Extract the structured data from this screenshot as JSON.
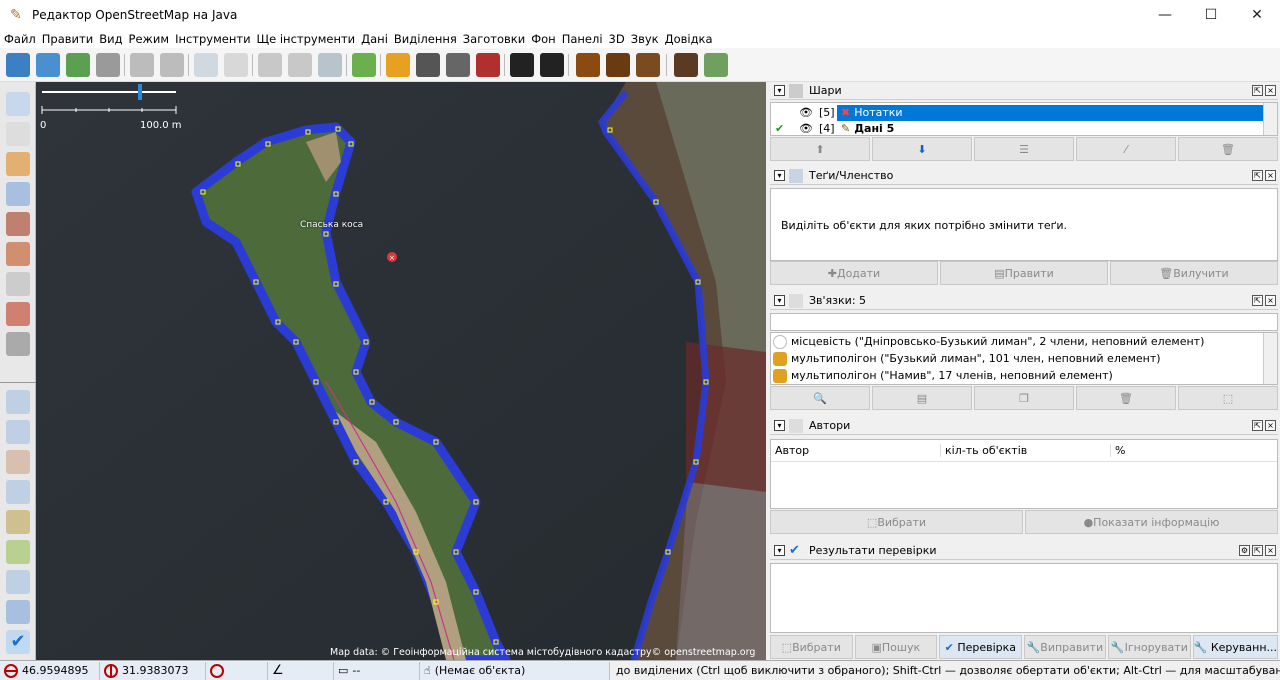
{
  "window": {
    "title": "Редактор OpenStreetMap на Java"
  },
  "menu": [
    "Файл",
    "Правити",
    "Вид",
    "Режим",
    "Інструменти",
    "Ще інструменти",
    "Дані",
    "Виділення",
    "Заготовки",
    "Фон",
    "Панелі",
    "3D",
    "Звук",
    "Довідка"
  ],
  "map": {
    "scale_label_start": "0",
    "scale_label_end": "100.0 m",
    "island_label": "Спаська коса",
    "attribution": "Map data: © Геоінформаційна система містобудівного кадастру© openstreetmap.org"
  },
  "layers_panel": {
    "title": "Шари",
    "layers": [
      {
        "index": "[5]",
        "name": "Нотатки",
        "selected": true
      },
      {
        "index": "[4]",
        "name": "Дані 5",
        "selected": false
      }
    ]
  },
  "tags_panel": {
    "title": "Теґи/Членство",
    "message": "Виділіть об'єкти для яких потрібно змінити теґи.",
    "buttons": [
      "Додати",
      "Правити",
      "Вилучити"
    ]
  },
  "relations_panel": {
    "title": "Зв'язки: 5",
    "items": [
      "місцевість (\"Дніпровсько-Бузький лиман\", 2 члени, неповний елемент)",
      "мультиполігон (\"Бузький лиман\", 101 член, неповний елемент)",
      "мультиполігон (\"Намив\", 17 членів, неповний елемент)"
    ]
  },
  "authors_panel": {
    "title": "Автори",
    "columns": [
      "Автор",
      "кіл-ть об'єктів",
      "%"
    ],
    "buttons": [
      "Вибрати",
      "Показати інформацію"
    ]
  },
  "validation_panel": {
    "title": "Результати перевірки",
    "buttons": [
      "Вибрати",
      "Пошук",
      "Перевірка",
      "Виправити",
      "Ігнорувати",
      "Керуванн..."
    ]
  },
  "status": {
    "lat": "46.9594895",
    "lon": "31.9383073",
    "length": "--",
    "object": "(Немає об'єкта)",
    "hint": "до виділених (Ctrl щоб виключити з обраного); Shift-Ctrl — дозволяє обертати об'єкти; Alt-Ctrl — для масштабування; або виділіть інше"
  },
  "colors": {
    "accent": "#0a64d6",
    "selection": "#0078d7",
    "way": "#2a3bd6",
    "node": "#ffff00"
  }
}
